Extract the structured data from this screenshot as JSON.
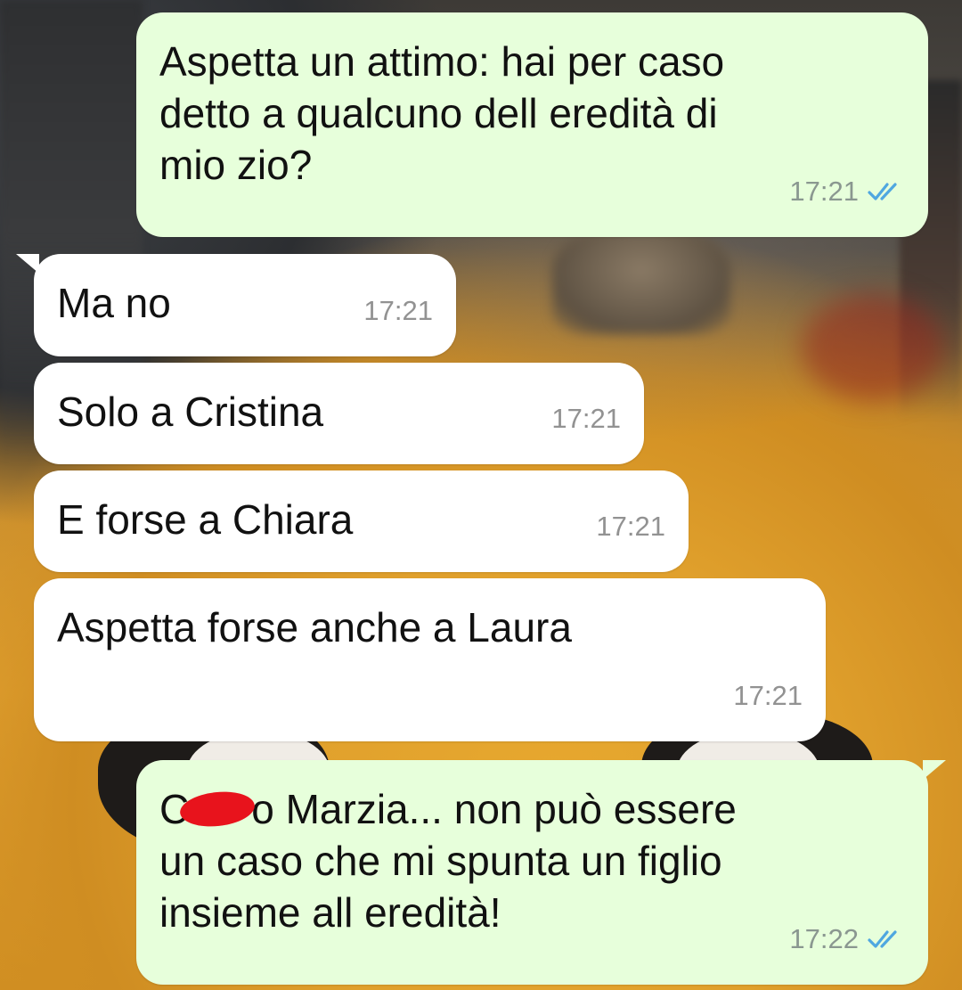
{
  "chat": {
    "messages": [
      {
        "direction": "outgoing",
        "text": "Aspetta un attimo: hai per caso\ndetto a qualcuno dell eredità di\nmio zio?",
        "time": "17:21",
        "status": "read",
        "status_icon": "double-check-icon"
      },
      {
        "direction": "incoming",
        "text": "Ma no",
        "time": "17:21"
      },
      {
        "direction": "incoming",
        "text": "Solo a Cristina",
        "time": "17:21"
      },
      {
        "direction": "incoming",
        "text": "E forse a Chiara",
        "time": "17:21"
      },
      {
        "direction": "incoming",
        "text": "Aspetta forse anche a Laura",
        "time": "17:21"
      },
      {
        "direction": "outgoing",
        "text_before_redaction": "C",
        "text_after_redaction": "o Marzia... non può essere\nun caso che mi spunta un figlio\ninsieme all eredità!",
        "time": "17:22",
        "status": "read",
        "status_icon": "double-check-icon"
      }
    ]
  },
  "colors": {
    "outgoing_bubble": "#e7ffdb",
    "incoming_bubble": "#ffffff",
    "read_tick": "#4fa7e0",
    "redaction": "#e8131c"
  }
}
